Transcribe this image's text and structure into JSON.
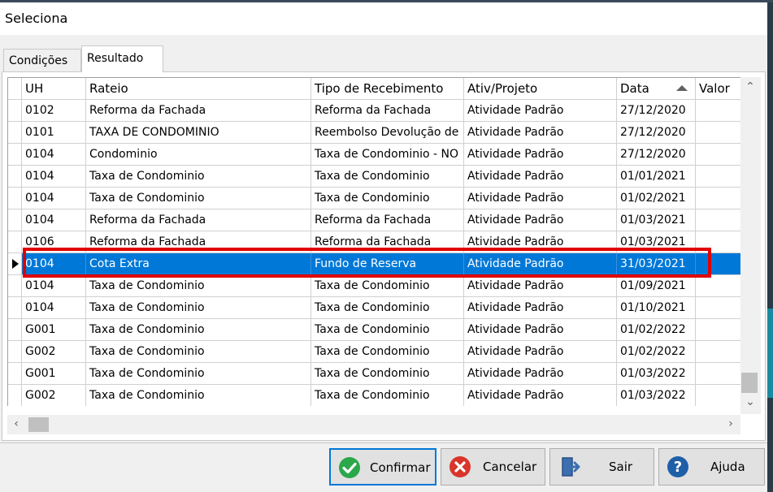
{
  "window": {
    "title": "Seleciona"
  },
  "tabs": [
    {
      "label": "Condições"
    },
    {
      "label": "Resultado"
    }
  ],
  "grid": {
    "columns": [
      "UH",
      "Rateio",
      "Tipo de Recebimento",
      "Ativ/Projeto",
      "Data",
      "Valor"
    ],
    "rows": [
      [
        "0102",
        "Reforma da Fachada",
        "Reforma da Fachada",
        "Atividade Padrão",
        "27/12/2020",
        ""
      ],
      [
        "0101",
        "TAXA DE CONDOMINIO",
        "Reembolso Devolução de",
        "Atividade Padrão",
        "27/12/2020",
        ""
      ],
      [
        "0104",
        "Condominio",
        "Taxa de Condominio - NO",
        "Atividade Padrão",
        "27/12/2020",
        ""
      ],
      [
        "0104",
        "Taxa de Condominio",
        "Taxa de Condominio",
        "Atividade Padrão",
        "01/01/2021",
        ""
      ],
      [
        "0104",
        "Taxa de Condominio",
        "Taxa de Condominio",
        "Atividade Padrão",
        "01/02/2021",
        ""
      ],
      [
        "0104",
        "Reforma da Fachada",
        "Reforma da Fachada",
        "Atividade Padrão",
        "01/03/2021",
        ""
      ],
      [
        "0106",
        "Reforma da Fachada",
        "Reforma da Fachada",
        "Atividade Padrão",
        "01/03/2021",
        ""
      ],
      [
        "0104",
        "Cota Extra",
        "Fundo de Reserva",
        "Atividade Padrão",
        "31/03/2021",
        ""
      ],
      [
        "0104",
        "Taxa de Condominio",
        "Taxa de Condominio",
        "Atividade Padrão",
        "01/09/2021",
        ""
      ],
      [
        "0104",
        "Taxa de Condominio",
        "Taxa de Condominio",
        "Atividade Padrão",
        "01/10/2021",
        ""
      ],
      [
        "G001",
        "Taxa de Condominio",
        "Taxa de Condominio",
        "Atividade Padrão",
        "01/02/2022",
        ""
      ],
      [
        "G002",
        "Taxa de Condominio",
        "Taxa de Condominio",
        "Atividade Padrão",
        "01/02/2022",
        ""
      ],
      [
        "G001",
        "Taxa de Condominio",
        "Taxa de Condominio",
        "Atividade Padrão",
        "01/03/2022",
        ""
      ],
      [
        "G002",
        "Taxa de Condominio",
        "Taxa de Condominio",
        "Atividade Padrão",
        "01/03/2022",
        ""
      ]
    ],
    "selected_row": 7,
    "sort_column": "Data",
    "sort_direction": "ascending"
  },
  "buttons": {
    "confirm": "Confirmar",
    "cancel": "Cancelar",
    "exit": "Sair",
    "help": "Ajuda"
  },
  "colors": {
    "selection": "#0078d7",
    "highlight_box": "#e00000",
    "confirm_icon": "#2aa84a",
    "cancel_icon": "#d9352b",
    "help_icon": "#1e5fa8"
  },
  "icons": {
    "confirm": "check-circle-icon",
    "cancel": "x-circle-icon",
    "exit": "exit-door-icon",
    "help": "question-circle-icon"
  }
}
